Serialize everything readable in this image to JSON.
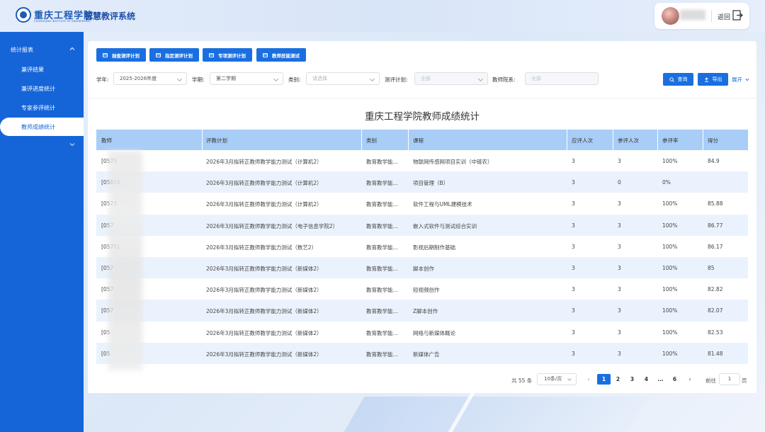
{
  "header": {
    "school_name": "重庆工程学院",
    "school_en": "CHONGQING INSTITUTE OF ENGINEERING",
    "system_title": "智慧教评系统",
    "back_label": "返回"
  },
  "sidebar": {
    "group_label": "统计报表",
    "items": [
      {
        "label": "兼评结果"
      },
      {
        "label": "兼评进度统计"
      },
      {
        "label": "专家参评统计"
      },
      {
        "label": "教师成绩统计"
      }
    ]
  },
  "toolbar": {
    "buttons": [
      {
        "label": "抽查测评计划"
      },
      {
        "label": "指定测评计划"
      },
      {
        "label": "专项测评计划"
      },
      {
        "label": "教师技能测试"
      }
    ]
  },
  "filters": {
    "year": {
      "label": "学年:",
      "value": "2025-2026年度"
    },
    "term": {
      "label": "学期:",
      "value": "第二学期"
    },
    "category": {
      "label": "类别:",
      "placeholder": "请选择"
    },
    "plan": {
      "label": "测评计划:",
      "placeholder": "全部"
    },
    "college": {
      "label": "教师院系:",
      "placeholder": "全部"
    },
    "query_label": "查询",
    "export_label": "导出",
    "expand_label": "展开"
  },
  "table": {
    "title": "重庆工程学院教师成绩统计",
    "columns": [
      "教师",
      "评教计划",
      "类别",
      "课程",
      "应评人次",
      "参评人次",
      "参评率",
      "得分"
    ],
    "rows": [
      [
        "[0575",
        "2026年3月拟转正教师教学能力测试（计算机2）",
        "教育教学能...",
        "物联网传感网项目实训（中链农）",
        "3",
        "3",
        "100%",
        "84.9"
      ],
      [
        "[05816",
        "2026年3月拟转正教师教学能力测试（计算机2）",
        "教育教学能...",
        "项目管理（B）",
        "3",
        "0",
        "0%",
        ""
      ],
      [
        "[0573",
        "2026年3月拟转正教师教学能力测试（计算机2）",
        "教育教学能...",
        "软件工程与UML建模技术",
        "3",
        "3",
        "100%",
        "85.88"
      ],
      [
        "[057",
        "2026年3月拟转正教师教学能力测试（电子信息学院2）",
        "教育教学能...",
        "嵌入式软件与测试综合实训",
        "3",
        "3",
        "100%",
        "86.77"
      ],
      [
        "[05781",
        "2026年3月拟转正教师教学能力测试（数艺2）",
        "教育教学能...",
        "影视后期制作基础",
        "3",
        "3",
        "100%",
        "86.17"
      ],
      [
        "[057",
        "2026年3月拟转正教师教学能力测试（新媒体2）",
        "教育教学能...",
        "脚本创作",
        "3",
        "3",
        "100%",
        "85"
      ],
      [
        "[057",
        "2026年3月拟转正教师教学能力测试（新媒体2）",
        "教育教学能...",
        "短视频创作",
        "3",
        "3",
        "100%",
        "82.82"
      ],
      [
        "[057",
        "2026年3月拟转正教师教学能力测试（新媒体2）",
        "教育教学能...",
        "Z脚本创作",
        "3",
        "3",
        "100%",
        "82.07"
      ],
      [
        "[05",
        "2026年3月拟转正教师教学能力测试（新媒体2）",
        "教育教学能...",
        "网络与新媒体概论",
        "3",
        "3",
        "100%",
        "82.53"
      ],
      [
        "[05",
        "2026年3月拟转正教师教学能力测试（新媒体2）",
        "教育教学能...",
        "新媒体广告",
        "3",
        "3",
        "100%",
        "81.48"
      ]
    ]
  },
  "pagination": {
    "total_label": "共 55 条",
    "page_size": "10条/页",
    "pages": [
      "1",
      "2",
      "3",
      "4",
      "...",
      "6"
    ],
    "current_page": "1",
    "goto_prefix": "前往",
    "goto_value": "1",
    "goto_suffix": "页"
  }
}
